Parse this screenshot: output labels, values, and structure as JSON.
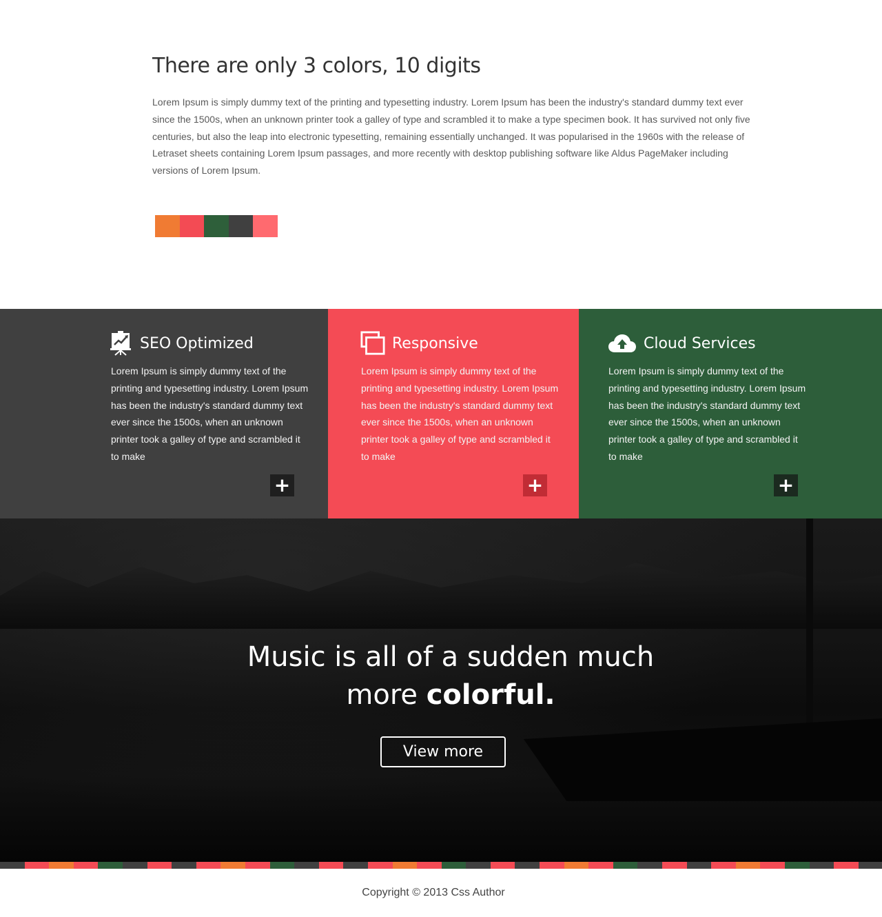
{
  "intro": {
    "title": "There are only 3 colors, 10 digits",
    "body": "Lorem Ipsum is simply dummy text of the printing and typesetting industry. Lorem Ipsum has been the industry's standard dummy text ever since the 1500s, when an unknown printer took a galley of type and scrambled it to make a type specimen book. It has survived not only five centuries, but also the leap into electronic typesetting, remaining essentially unchanged. It was popularised in the 1960s with the release of Letraset sheets containing Lorem Ipsum passages, and more recently with desktop publishing software like Aldus PageMaker including versions of Lorem Ipsum.",
    "swatches": [
      "#f07b33",
      "#f34b54",
      "#2e5f3a",
      "#404040",
      "#ff6a6f"
    ]
  },
  "features": [
    {
      "title": "SEO Optimized",
      "icon": "presentation-chart-icon",
      "text": "Lorem Ipsum is simply dummy text of the printing and typesetting industry. Lorem Ipsum has been the industry's standard dummy text ever since the 1500s, when an unknown printer took a galley of type and scrambled it to make",
      "button": "+",
      "bg": "#404040",
      "button_bg": "#1f1f1f"
    },
    {
      "title": "Responsive",
      "icon": "overlapping-windows-icon",
      "text": "Lorem Ipsum is simply dummy text of the printing and typesetting industry. Lorem Ipsum has been the industry's standard dummy text ever since the 1500s, when an unknown printer took a galley of type and scrambled it to make",
      "button": "+",
      "bg": "#f44b55",
      "button_bg": "#c12c35"
    },
    {
      "title": "Cloud Services",
      "icon": "cloud-upload-icon",
      "text": "Lorem Ipsum is simply dummy text of the printing and typesetting industry. Lorem Ipsum has been the industry's standard dummy text ever since the 1500s, when an unknown printer took a galley of type and scrambled it to make",
      "button": "+",
      "bg": "#2d5e3a",
      "button_bg": "#1b2a1f"
    }
  ],
  "hero": {
    "line1": "Music is all of a sudden much",
    "line2_light": "more ",
    "line2_bold": "colorful.",
    "button": "View more"
  },
  "stripe_colors": [
    "#404040",
    "#f44b55",
    "#f07b33",
    "#f44b55",
    "#2d5e3a",
    "#404040",
    "#f44b55"
  ],
  "footer": {
    "copyright": "Copyright © 2013 Css Author"
  }
}
